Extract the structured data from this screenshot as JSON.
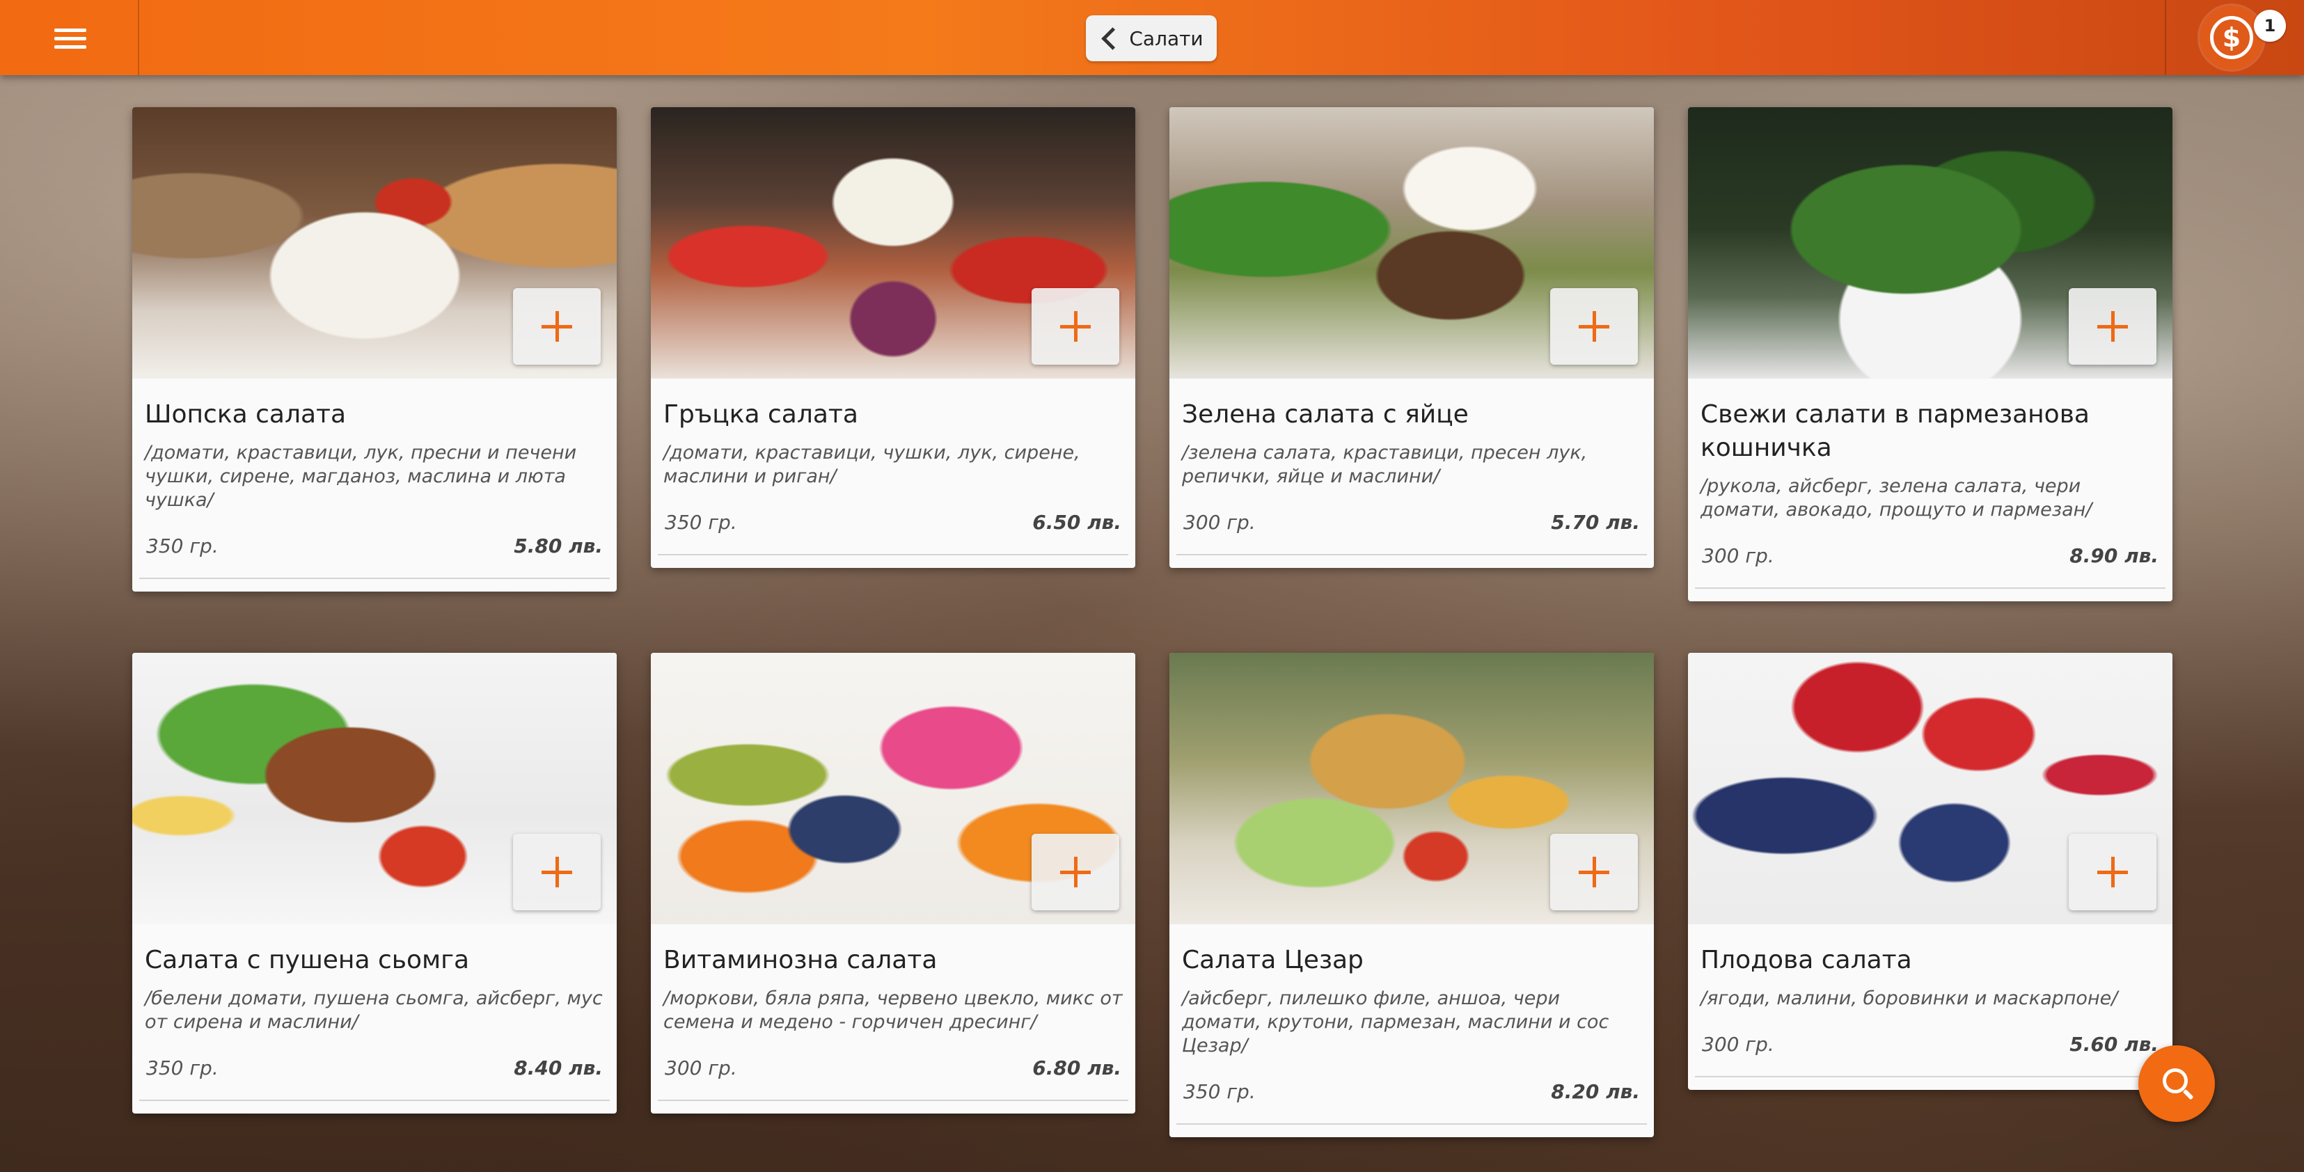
{
  "topbar": {
    "back_label": "Салати",
    "cart_badge": "1",
    "cart_symbol": "$",
    "accent_color": "#f26a12"
  },
  "products": [
    {
      "title": "Шопска салата",
      "desc": "/домати, краставици, лук, пресни и печени чушки, сирене, магданоз, маслина и люта чушка/",
      "weight": "350 гр.",
      "price": "5.80 лв."
    },
    {
      "title": "Гръцка салата",
      "desc": "/домати, краставици, чушки, лук, сирене, маслини и риган/",
      "weight": "350 гр.",
      "price": "6.50 лв."
    },
    {
      "title": "Зелена салата с яйце",
      "desc": "/зелена салата, краставици, пресен лук, репички, яйце и маслини/",
      "weight": "300 гр.",
      "price": "5.70 лв."
    },
    {
      "title": "Свежи салати в пармезанова кошничка",
      "desc": "/рукола, айсберг, зелена салата, чери домати, авокадо, прощуто и пармезан/",
      "weight": "300 гр.",
      "price": "8.90 лв."
    },
    {
      "title": "Салата с пушена сьомга",
      "desc": "/белени домати, пушена сьомга, айсберг, мус от сирена и маслини/",
      "weight": "350 гр.",
      "price": "8.40 лв."
    },
    {
      "title": "Витаминозна салата",
      "desc": "/моркови, бяла ряпа, червено цвекло, микс от семена и медено - горчичен дресинг/",
      "weight": "300 гр.",
      "price": "6.80 лв."
    },
    {
      "title": "Салата Цезар",
      "desc": "/айсберг, пилешко филе, аншоа, чери домати, крутони, пармезан, маслини и сос Цезар/",
      "weight": "350 гр.",
      "price": "8.20 лв."
    },
    {
      "title": "Плодова салата",
      "desc": "/ягоди, малини, боровинки и маскарпоне/",
      "weight": "300 гр.",
      "price": "5.60 лв."
    }
  ]
}
